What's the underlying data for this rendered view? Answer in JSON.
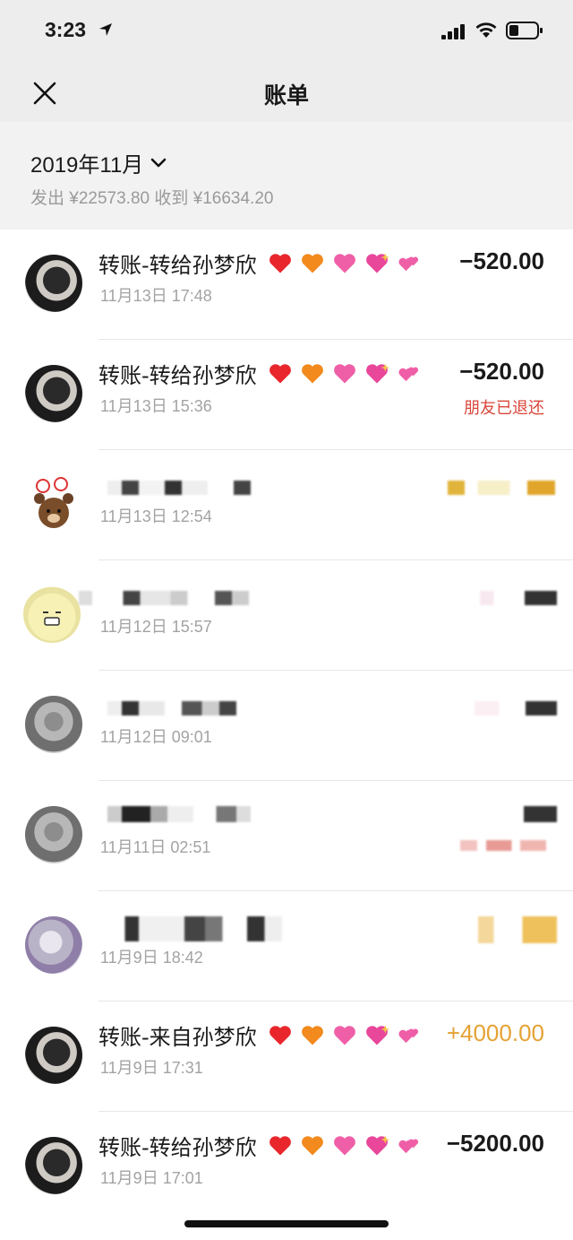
{
  "status_bar": {
    "time": "3:23"
  },
  "nav": {
    "title": "账单"
  },
  "month": {
    "label": "2019年11月",
    "summary": "发出 ¥22573.80 收到 ¥16634.20"
  },
  "rows": [
    {
      "title": "转账-转给孙梦欣",
      "hearts": true,
      "time": "11月13日 17:48",
      "amount": "−520.00",
      "status": ""
    },
    {
      "title": "转账-转给孙梦欣",
      "hearts": true,
      "time": "11月13日 15:36",
      "amount": "−520.00",
      "status": "朋友已退还"
    },
    {
      "title": "",
      "hearts": false,
      "time": "11月13日 12:54",
      "amount": "",
      "status": ""
    },
    {
      "title": "",
      "hearts": false,
      "time": "11月12日 15:57",
      "amount": "",
      "status": ""
    },
    {
      "title": "",
      "hearts": false,
      "time": "11月12日 09:01",
      "amount": "",
      "status": ""
    },
    {
      "title": "",
      "hearts": false,
      "time": "11月11日 02:51",
      "amount": "",
      "status": ""
    },
    {
      "title": "",
      "hearts": false,
      "time": "11月9日 18:42",
      "amount": "",
      "status": ""
    },
    {
      "title": "转账-来自孙梦欣",
      "hearts": true,
      "time": "11月9日 17:31",
      "amount": "+4000.00",
      "status": ""
    },
    {
      "title": "转账-转给孙梦欣",
      "hearts": true,
      "time": "11月9日 17:01",
      "amount": "−5200.00",
      "status": ""
    }
  ],
  "icons": {
    "close": "close-icon",
    "chevron": "chevron-down-icon",
    "heart_colors": [
      "#e8262b",
      "#f28a1e",
      "#ef5fa7",
      "#e8479a",
      "#ef5fa7"
    ]
  },
  "colors": {
    "income": "#e5a235",
    "refund_status": "#d9473b",
    "secondary_text": "#a3a3a3"
  }
}
